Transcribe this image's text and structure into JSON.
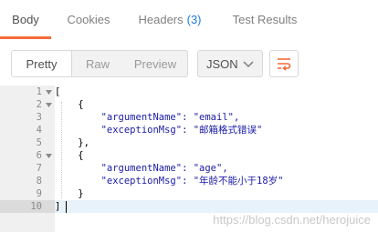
{
  "tabs": [
    {
      "label": "Body",
      "active": true
    },
    {
      "label": "Cookies",
      "active": false
    },
    {
      "label": "Headers",
      "count": "(3)",
      "active": false
    },
    {
      "label": "Test Results",
      "active": false
    }
  ],
  "toolbar": {
    "view_modes": [
      "Pretty",
      "Raw",
      "Preview"
    ],
    "active_view": "Pretty",
    "format_select": "JSON"
  },
  "editor": {
    "line_numbers": [
      "1",
      "2",
      "3",
      "4",
      "5",
      "6",
      "7",
      "8",
      "9",
      "10"
    ],
    "active_line": "10",
    "lines": [
      "[",
      "    {",
      "        \"argumentName\": \"email\",",
      "        \"exceptionMsg\": \"邮箱格式错误\"",
      "    },",
      "    {",
      "        \"argumentName\": \"age\",",
      "        \"exceptionMsg\": \"年龄不能小于18岁\"",
      "    }",
      "]"
    ]
  },
  "watermark": "https://blog.csdn.net/herojuice",
  "colors": {
    "accent": "#f26b3a",
    "tab_count": "#1f7bd8",
    "gutter": "#f0f0f0"
  }
}
